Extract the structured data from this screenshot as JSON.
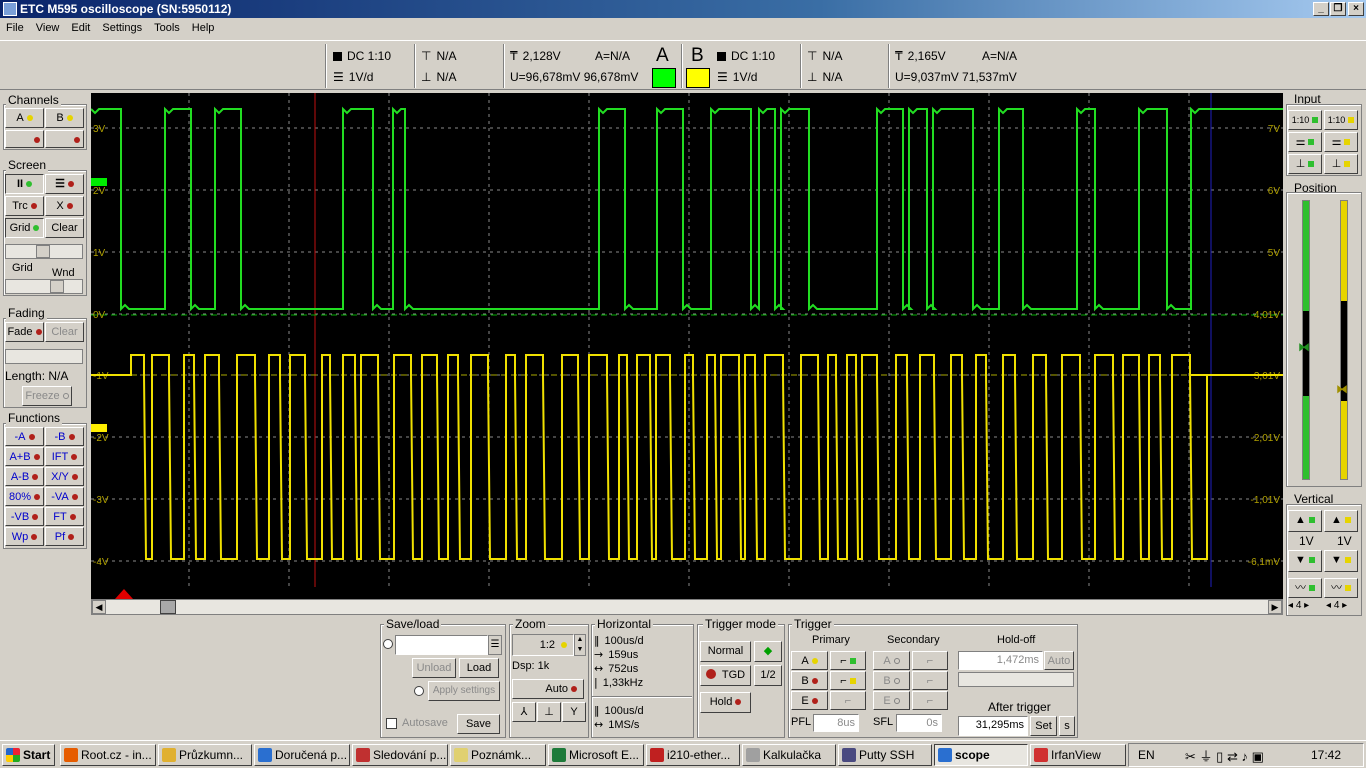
{
  "window": {
    "title": "ETC M595 oscilloscope (SN:5950112)",
    "minimize": "_",
    "restore": "❐",
    "close": "×"
  },
  "menu": [
    "File",
    "View",
    "Edit",
    "Settings",
    "Tools",
    "Help"
  ],
  "channelA": {
    "coupling": "DC 1:10",
    "volts_per_div": "1V/d",
    "t_top": "N/A",
    "t_bottom": "N/A",
    "level": "2,128V",
    "delta_a": "A=N/A",
    "u_value": "U=96,678mV 96,678mV",
    "label": "A",
    "color": "#00ff00"
  },
  "channelB": {
    "label": "B",
    "coupling": "DC 1:10",
    "volts_per_div": "1V/d",
    "t_top": "N/A",
    "t_bottom": "N/A",
    "level": "2,165V",
    "delta_a": "A=N/A",
    "u_value": "U=9,037mV 71,537mV",
    "color": "#ffff00"
  },
  "left": {
    "channels_title": "Channels",
    "ch_a": "A",
    "ch_b": "B",
    "screen_title": "Screen",
    "trc": "Trc",
    "x": "X",
    "grid": "Grid",
    "clear": "Clear",
    "grid_label": "Grid",
    "wnd_label": "Wnd",
    "fading_title": "Fading",
    "fade": "Fade",
    "fade_clear": "Clear",
    "length": "Length: N/A",
    "freeze": "Freeze",
    "functions_title": "Functions",
    "functions": [
      "-A",
      "-B",
      "A+B",
      "IFT",
      "A-B",
      "X/Y",
      "80%",
      "-VA",
      "-VB",
      "FT",
      "Wp",
      "Pf"
    ]
  },
  "right": {
    "input_title": "Input",
    "ratio_a": "1:10",
    "ratio_b": "1:10",
    "position_title": "Position",
    "vertical_title": "Vertical",
    "v_a": "1V",
    "v_b": "1V",
    "n_a": "4",
    "n_b": "4"
  },
  "scope": {
    "left_labels": [
      "3V",
      "2V",
      "1V",
      "0V",
      "-1V",
      "-2V",
      "-3V",
      "-4V"
    ],
    "right_labels": [
      "7V",
      "6V",
      "5V",
      "4,01V",
      "3,01V",
      "-2,01V",
      "-1,01V",
      "-6,1mV"
    ],
    "trace_a_color": "#22dd22",
    "trace_b_color": "#f0e000"
  },
  "bottom": {
    "saveload_title": "Save/load",
    "unload": "Unload",
    "load": "Load",
    "apply": "Apply settings",
    "autosave": "Autosave",
    "save": "Save",
    "zoom_title": "Zoom",
    "zoom_value": "1:2",
    "dsp": "Dsp:  1k",
    "auto": "Auto",
    "horizontal_title": "Horizontal",
    "h_rows": [
      "100us/d",
      "159us",
      "752us",
      "1,33kHz"
    ],
    "h2_rows": [
      "100us/d",
      "1MS/s"
    ],
    "tmode_title": "Trigger mode",
    "normal": "Normal",
    "tgd": "TGD",
    "half": "1/2",
    "hold": "Hold",
    "trigger_title": "Trigger",
    "primary": "Primary",
    "secondary": "Secondary",
    "holdoff": "Hold-off",
    "ta": "A",
    "tb": "B",
    "te": "E",
    "holdoff_value": "1,472ms",
    "holdoff_auto": "Auto",
    "after_trigger": "After trigger",
    "after_value": "31,295ms",
    "set": "Set",
    "s": "s",
    "pfl": "PFL",
    "pfl_value": "8us",
    "sfl": "SFL",
    "sfl_value": "0s"
  },
  "taskbar": {
    "start": "Start",
    "tasks": [
      "Root.cz - in...",
      "Průzkumn...",
      "Doručená p...",
      "Sledování p...",
      "Poznámk...",
      "Microsoft E...",
      "i210-ether...",
      "Kalkulačka",
      "Putty SSH",
      "scope",
      "IrfanView"
    ],
    "lang": "EN",
    "clock": "17:42"
  }
}
